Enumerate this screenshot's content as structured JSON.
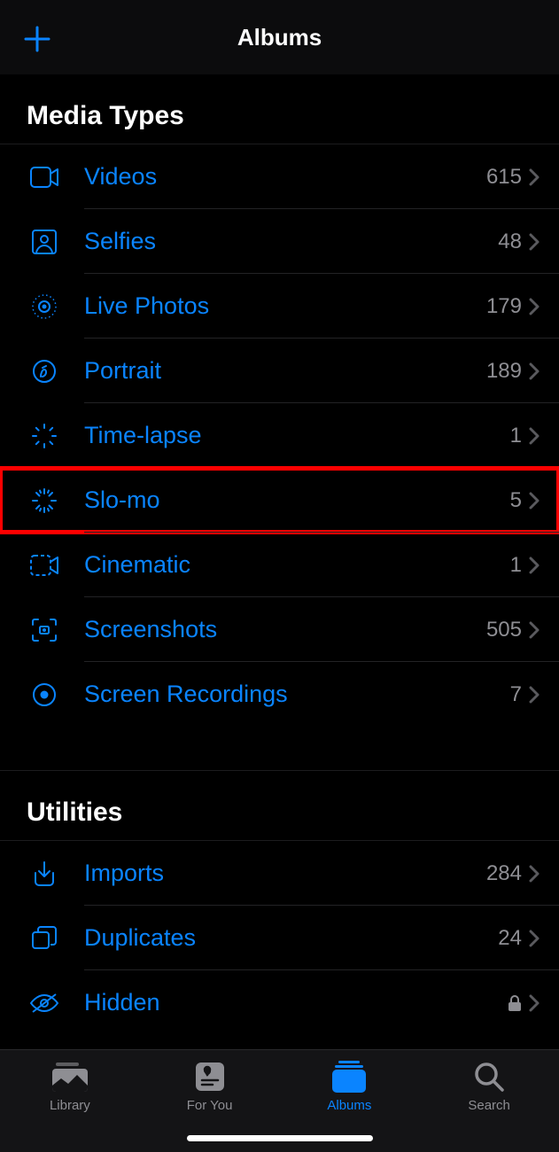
{
  "header": {
    "title": "Albums"
  },
  "sections": {
    "media_types": {
      "title": "Media Types",
      "items": [
        {
          "label": "Videos",
          "count": "615"
        },
        {
          "label": "Selfies",
          "count": "48"
        },
        {
          "label": "Live Photos",
          "count": "179"
        },
        {
          "label": "Portrait",
          "count": "189"
        },
        {
          "label": "Time-lapse",
          "count": "1"
        },
        {
          "label": "Slo-mo",
          "count": "5"
        },
        {
          "label": "Cinematic",
          "count": "1"
        },
        {
          "label": "Screenshots",
          "count": "505"
        },
        {
          "label": "Screen Recordings",
          "count": "7"
        }
      ]
    },
    "utilities": {
      "title": "Utilities",
      "items": [
        {
          "label": "Imports",
          "count": "284"
        },
        {
          "label": "Duplicates",
          "count": "24"
        },
        {
          "label": "Hidden",
          "locked": true
        }
      ]
    }
  },
  "tabs": [
    {
      "label": "Library"
    },
    {
      "label": "For You"
    },
    {
      "label": "Albums"
    },
    {
      "label": "Search"
    }
  ]
}
